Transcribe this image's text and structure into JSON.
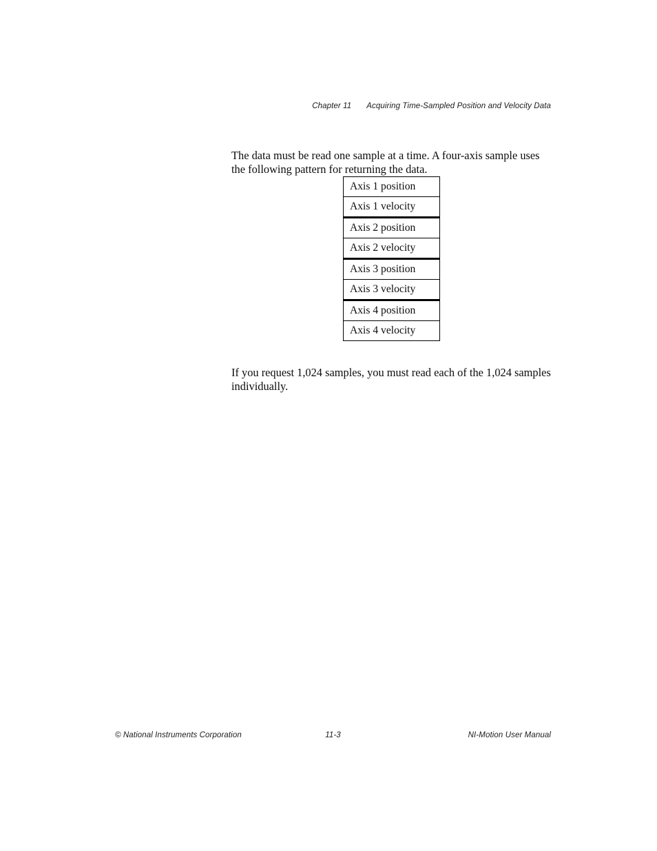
{
  "header": {
    "chapter": "Chapter 11",
    "title": "Acquiring Time-Sampled Position and Velocity Data"
  },
  "body": {
    "intro_paragraph": "The data must be read one sample at a time. A four-axis sample uses the following pattern for returning the data.",
    "outro_paragraph": "If you request 1,024 samples, you must read each of the 1,024 samples individually."
  },
  "sample_table": {
    "rows": [
      {
        "label": "Axis 1 position",
        "group_end": false
      },
      {
        "label": "Axis 1 velocity",
        "group_end": true
      },
      {
        "label": "Axis 2 position",
        "group_end": false
      },
      {
        "label": "Axis 2 velocity",
        "group_end": true
      },
      {
        "label": "Axis 3 position",
        "group_end": false
      },
      {
        "label": "Axis 3 velocity",
        "group_end": true
      },
      {
        "label": "Axis 4 position",
        "group_end": false
      },
      {
        "label": "Axis 4 velocity",
        "group_end": false
      }
    ]
  },
  "footer": {
    "copyright": "© National Instruments Corporation",
    "page_number": "11-3",
    "manual_title": "NI-Motion User Manual"
  }
}
